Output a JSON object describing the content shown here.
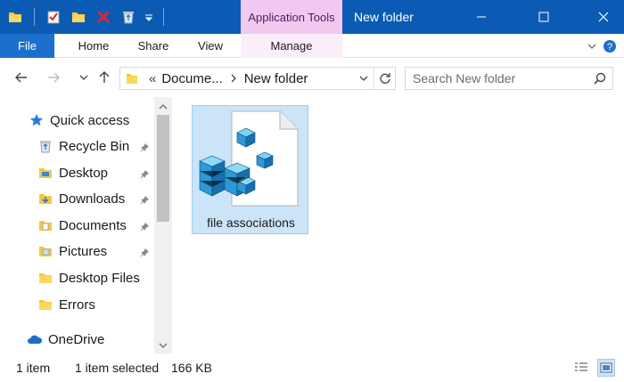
{
  "window": {
    "contextual_tab": "Application Tools",
    "title": "New folder"
  },
  "ribbon": {
    "tabs": [
      "File",
      "Home",
      "Share",
      "View",
      "Manage"
    ]
  },
  "address": {
    "overflow": "«",
    "segments": [
      "Docume...",
      "New folder"
    ]
  },
  "search": {
    "placeholder": "Search New folder"
  },
  "nav_pane": {
    "quick_access": "Quick access",
    "items": [
      "Recycle Bin",
      "Desktop",
      "Downloads",
      "Documents",
      "Pictures",
      "Desktop Files",
      "Errors"
    ],
    "onedrive": "OneDrive"
  },
  "content": {
    "file_name": "file associations",
    "icon": "registry-file-icon"
  },
  "status": {
    "item_count": "1 item",
    "selected": "1 item selected",
    "size": "166 KB"
  },
  "colors": {
    "titlebar": "#0b5bb5",
    "file_tab": "#1c6fcc",
    "context_tab": "#f0c8f0",
    "selection": "#cce4f7"
  }
}
